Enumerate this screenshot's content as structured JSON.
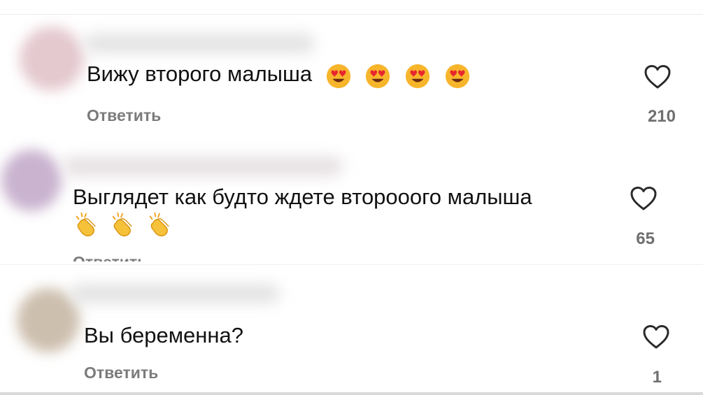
{
  "comments": [
    {
      "text": "Вижу второго малыша",
      "emojis": [
        "heart-eyes-emoji",
        "heart-eyes-emoji",
        "heart-eyes-emoji",
        "heart-eyes-emoji"
      ],
      "reply_label": "Ответить",
      "likes": "210"
    },
    {
      "text": "Выглядет как будто ждете второоого малыша",
      "emojis": [
        "clapping-hands-emoji",
        "clapping-hands-emoji",
        "clapping-hands-emoji"
      ],
      "reply_label": "Ответить",
      "likes": "65"
    },
    {
      "text": "Вы беременна?",
      "emojis": [],
      "reply_label": "Ответить",
      "likes": "1"
    }
  ],
  "icons": {
    "like": "heart-outline-icon"
  },
  "colors": {
    "text": "#111111",
    "secondary_text": "#7b7b7b",
    "heart_stroke": "#2a2a2a"
  }
}
